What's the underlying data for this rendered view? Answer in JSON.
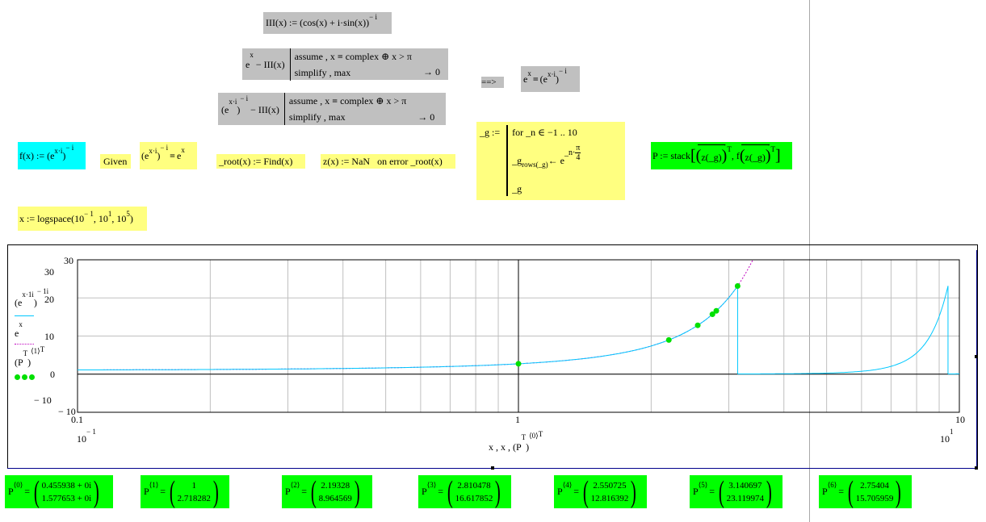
{
  "row1": {
    "text": "III(x) := (cos(x) + i·sin(x))",
    "exp": "− i"
  },
  "row2": {
    "lhs_base": "e",
    "lhs_exp": "x",
    "lhs_rest": " − III(x)",
    "kw1": "assume , x",
    "eq": "=",
    "kw1b": " complex ⊕ x > π",
    "kw2": "simplify , max",
    "result": "→ 0"
  },
  "row3": {
    "lhs": "(e",
    "lhs_exp": "x·i",
    "lhs_close": ")",
    "lhs_exp2": "− i",
    "lhs_rest": " − III(x)",
    "kw1": "assume , x",
    "eq": "=",
    "kw1b": " complex ⊕ x > π",
    "kw2": "simplify , max",
    "result": "→ 0"
  },
  "implies": {
    "arrow": "==>",
    "lhs": "e",
    "lhs_exp": "x",
    "eq": "=",
    "rhs": "(e",
    "rhs_exp": "x·i",
    "rhs_close": ")",
    "rhs_exp2": "− i"
  },
  "f_def": {
    "text": "f(x) := (e",
    "exp": "x·i",
    "close": ")",
    "exp2": "− i"
  },
  "given": {
    "label": "Given"
  },
  "given_eq": {
    "lhs": "(e",
    "lhs_exp": "x·i",
    "lhs_close": ")",
    "lhs_exp2": "− i",
    "eq": "=",
    "rhs": "e",
    "rhs_exp": "x"
  },
  "root_def": {
    "text": "_root(x) := Find(x)"
  },
  "z_def": {
    "text": "z(x) := NaN   on error _root(x)"
  },
  "g_def": {
    "name": "_g :=",
    "line1": "for  _n ∈ −1 .. 10",
    "line2a": "_g",
    "line2sub": "rows(_g)",
    "line2b": " ← e",
    "line2exp": "_n·",
    "line2num": "π",
    "line2den": "4",
    "line3": "_g"
  },
  "p_def": {
    "text": "P := stack",
    "part1": "z(_g)",
    "part2": "f(z(_g))",
    "sup": "T"
  },
  "x_def": {
    "text": "x := logspace(10",
    "e1": "− 1",
    "mid": ", 10",
    "e2": "1",
    "mid2": ", 10",
    "e3": "5",
    "close": ")"
  },
  "plot": {
    "y_ticks": [
      "30",
      "20",
      "10",
      "0",
      "− 10"
    ],
    "y_end_top": "30",
    "y_end_bottom": "− 10",
    "x_ticks": [
      "0.1",
      "1",
      "10"
    ],
    "x_under_left_base": "10",
    "x_under_left_exp": "− 1",
    "x_under_right_base": "10",
    "x_under_right_exp": "1",
    "xlabel": "x , x , (P",
    "xlabel_sup": "T",
    "xlabel_close": ")",
    "xlabel_col": "⟨0⟩",
    "xlabel_T": "T",
    "legend1": "(e",
    "legend1_exp": "x·1i",
    "legend1_close": ")",
    "legend1_exp2": "− 1i",
    "legend2": "e",
    "legend2_exp": "x",
    "legend3": "(P",
    "legend3_sup": "T",
    "legend3_close": ")",
    "legend3_col": "⟨1⟩",
    "legend3_T": "T",
    "colors": {
      "series1": "#00c8ff",
      "series2": "#c000c0",
      "series3": "#00e000",
      "grid": "#c0c0c0"
    }
  },
  "chart_data": {
    "type": "line",
    "xscale": "log",
    "xlim": [
      0.1,
      10
    ],
    "ylim": [
      -10,
      30
    ],
    "series": [
      {
        "name": "(e^(x·1i))^(−1i)",
        "x": [
          0.1,
          0.2,
          0.5,
          1,
          1.5,
          2,
          2.5,
          3,
          3.14,
          3.15,
          5,
          7,
          8,
          9,
          9.3,
          9.42,
          9.43,
          10
        ],
        "y": [
          1.105,
          1.221,
          1.649,
          2.718,
          4.482,
          7.389,
          12.18,
          20.09,
          23.1,
          0.01,
          0.02,
          0.2,
          0.8,
          5.5,
          11,
          23.1,
          0.01,
          0.01
        ]
      },
      {
        "name": "e^x",
        "x": [
          0.1,
          1,
          2,
          3,
          3.2,
          3.4
        ],
        "y": [
          1.105,
          2.718,
          7.389,
          20.09,
          24.5,
          30
        ]
      },
      {
        "name": "(P^T)^⟨1⟩^T",
        "x": [
          1,
          2.19328,
          2.550725,
          2.75404,
          2.810478,
          3.140697
        ],
        "y": [
          2.718282,
          8.964569,
          12.816392,
          15.705959,
          16.617852,
          23.119974
        ]
      }
    ]
  },
  "pvals": [
    {
      "label": "P",
      "col": "⟨0⟩",
      "v1": "0.455938 + 0i",
      "v2": "1.577653 + 0i"
    },
    {
      "label": "P",
      "col": "⟨1⟩",
      "v1": "1",
      "v2": "2.718282"
    },
    {
      "label": "P",
      "col": "⟨2⟩",
      "v1": "2.19328",
      "v2": "8.964569"
    },
    {
      "label": "P",
      "col": "⟨3⟩",
      "v1": "2.810478",
      "v2": "16.617852"
    },
    {
      "label": "P",
      "col": "⟨4⟩",
      "v1": "2.550725",
      "v2": "12.816392"
    },
    {
      "label": "P",
      "col": "⟨5⟩",
      "v1": "3.140697",
      "v2": "23.119974"
    },
    {
      "label": "P",
      "col": "⟨6⟩",
      "v1": "2.75404",
      "v2": "15.705959"
    }
  ],
  "eq_sign": "="
}
